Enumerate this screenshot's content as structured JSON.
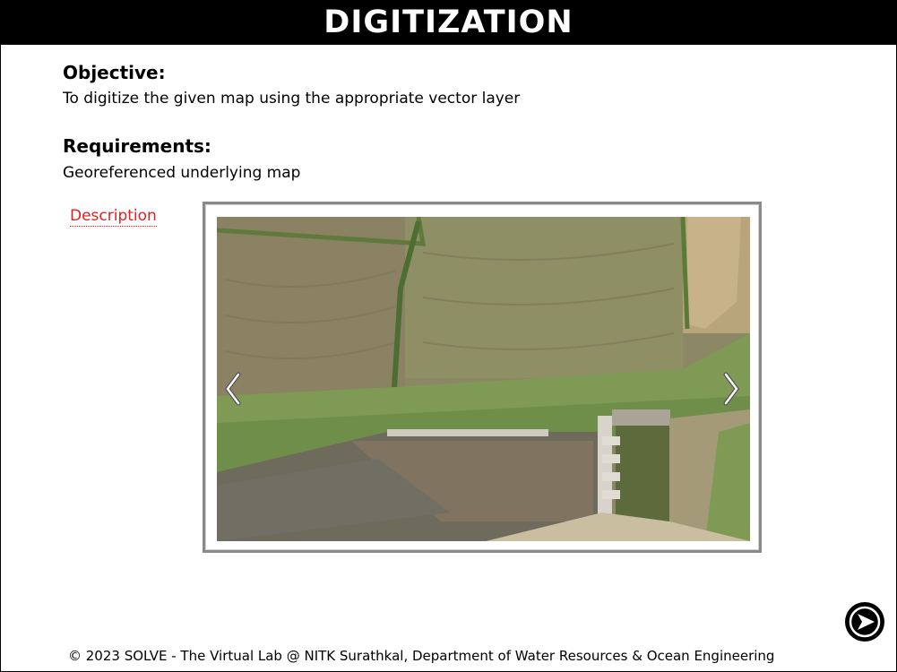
{
  "header": {
    "title": "DIGITIZATION"
  },
  "objective": {
    "heading": "Objective:",
    "text": "To digitize the given map using the appropriate vector layer"
  },
  "requirements": {
    "heading": "Requirements:",
    "text": "Georeferenced underlying map"
  },
  "description_link": {
    "label": "Description"
  },
  "slider": {
    "image_description": "aerial photo of fields, a stream and a check dam",
    "prev_icon": "chevron-left-icon",
    "next_icon": "chevron-right-icon"
  },
  "next_button": {
    "icon": "arrow-right-circle-icon"
  },
  "footer": {
    "text": "© 2023 SOLVE - The Virtual Lab @ NITK Surathkal, Department of Water Resources & Ocean Engineering"
  },
  "colors": {
    "title_bg": "#000000",
    "title_text": "#ffffff",
    "link": "#e02020",
    "slider_border": "#8a8a8a"
  }
}
